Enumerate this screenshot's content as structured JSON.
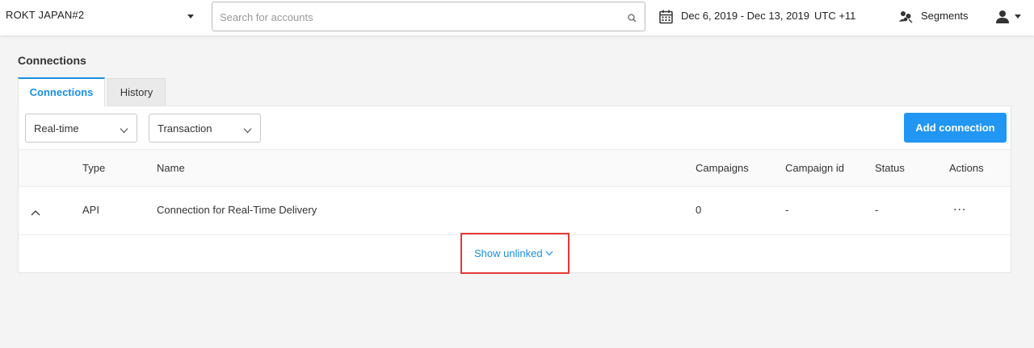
{
  "header": {
    "account_name": "ROKT JAPAN#2",
    "search_placeholder": "Search for accounts",
    "date_range": "Dec 6, 2019 - Dec 13, 2019",
    "timezone": "UTC +11",
    "segments_label": "Segments"
  },
  "page": {
    "title": "Connections",
    "tabs": [
      {
        "label": "Connections",
        "active": true
      },
      {
        "label": "History",
        "active": false
      }
    ]
  },
  "filters": {
    "delivery": "Real-time",
    "connection_type": "Transaction"
  },
  "actions": {
    "add_connection": "Add connection"
  },
  "table": {
    "columns": [
      "Type",
      "Name",
      "Campaigns",
      "Campaign id",
      "Status",
      "Actions"
    ],
    "rows": [
      {
        "type": "API",
        "name": "Connection for Real-Time Delivery",
        "campaigns": "0",
        "campaign_id": "-",
        "status": "-",
        "actions": "..."
      }
    ],
    "show_unlinked": "Show unlinked"
  },
  "colors": {
    "accent": "#1a8fe3",
    "button": "#2196f3",
    "highlight": "#e53935"
  }
}
